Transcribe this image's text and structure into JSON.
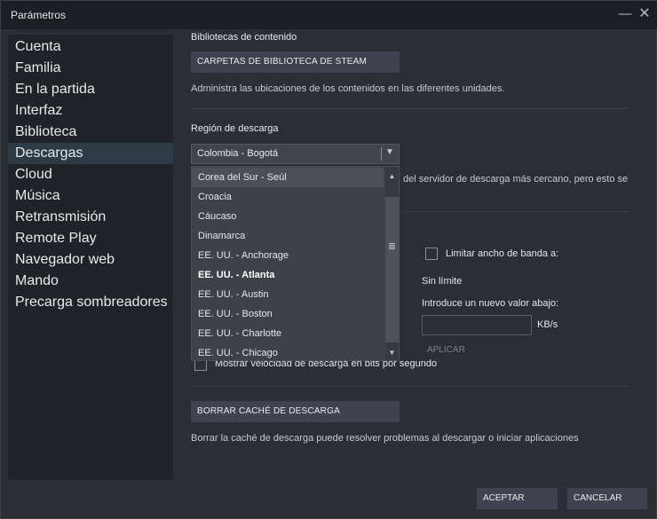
{
  "window": {
    "title": "Parámetros",
    "minimize_icon": "—",
    "close_icon": "✕"
  },
  "sidebar": {
    "items": [
      {
        "label": "Cuenta"
      },
      {
        "label": "Familia"
      },
      {
        "label": "En la partida"
      },
      {
        "label": "Interfaz"
      },
      {
        "label": "Biblioteca"
      },
      {
        "label": "Descargas",
        "selected": true
      },
      {
        "label": "Cloud"
      },
      {
        "label": "Música"
      },
      {
        "label": "Retransmisión"
      },
      {
        "label": "Remote Play"
      },
      {
        "label": "Navegador web"
      },
      {
        "label": "Mando"
      },
      {
        "label": "Precarga sombreadores"
      }
    ]
  },
  "content_libraries": {
    "title": "Bibliotecas de contenido",
    "button": "CARPETAS DE BIBLIOTECA DE STEAM",
    "description": "Administra las ubicaciones de los contenidos en las diferentes unidades."
  },
  "region": {
    "title": "Región de descarga",
    "selected": "Colombia - Bogotá",
    "description_partial": "del servidor de descarga más cercano, pero esto se",
    "options": [
      {
        "label": "Corea del Sur - Seúl",
        "hover": true
      },
      {
        "label": "Croacia"
      },
      {
        "label": "Cáucaso"
      },
      {
        "label": "Dinamarca"
      },
      {
        "label": "EE. UU. - Anchorage"
      },
      {
        "label": "EE. UU. - Atlanta",
        "bold": true
      },
      {
        "label": "EE. UU. - Austin"
      },
      {
        "label": "EE. UU. - Boston"
      },
      {
        "label": "EE. UU. - Charlotte"
      },
      {
        "label": "EE. UU. - Chicago"
      }
    ]
  },
  "bandwidth": {
    "limit_label": "Limitar ancho de banda a:",
    "current": "Sin límite",
    "prompt": "Introduce un nuevo valor abajo:",
    "value": "",
    "unit": "KB/s",
    "apply": "APLICAR"
  },
  "show_bits": {
    "label": "Mostrar velocidad de descarga en bits por segundo"
  },
  "cache": {
    "button": "BORRAR CACHÉ DE DESCARGA",
    "description": "Borrar la caché de descarga puede resolver problemas al descargar o iniciar aplicaciones"
  },
  "footer": {
    "accept": "ACEPTAR",
    "cancel": "CANCELAR"
  },
  "colors": {
    "background": "#2a2e35",
    "sidebar": "#1f2227",
    "selected": "#2f3a47",
    "button": "#3d4450"
  }
}
